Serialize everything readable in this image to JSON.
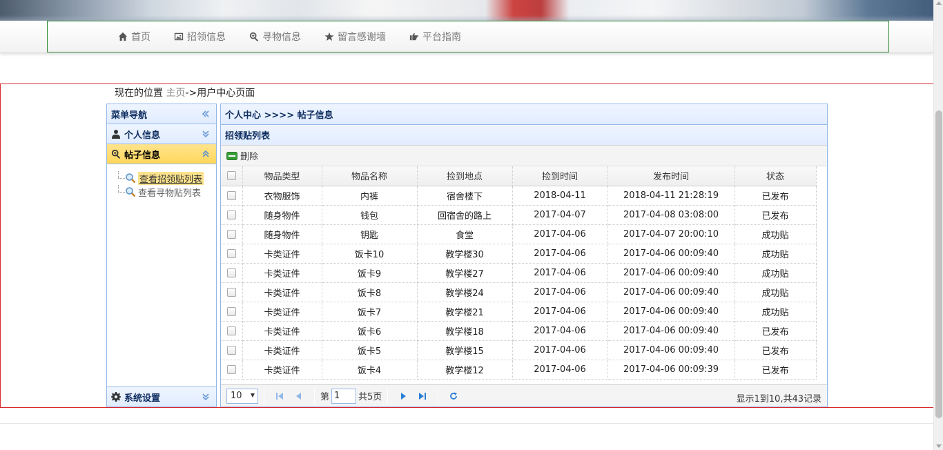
{
  "nav": {
    "items": [
      {
        "label": "首页",
        "icon": "home-icon"
      },
      {
        "label": "招领信息",
        "icon": "picture-icon"
      },
      {
        "label": "寻物信息",
        "icon": "zoom-in-icon"
      },
      {
        "label": "留言感谢墙",
        "icon": "star-icon"
      },
      {
        "label": "平台指南",
        "icon": "hand-right-icon"
      }
    ]
  },
  "breadcrumb": {
    "prefix": "现在的位置",
    "home": "主页",
    "current": "->用户中心页面"
  },
  "menu": {
    "title": "菜单导航",
    "personal": "个人信息",
    "posts": "帖子信息",
    "tree": [
      "查看招领贴列表",
      "查看寻物贴列表"
    ],
    "settings": "系统设置"
  },
  "content": {
    "path": "个人中心 >>>> 帖子信息",
    "list_title": "招领贴列表",
    "delete_label": "删除",
    "columns": [
      "物品类型",
      "物品名称",
      "捡到地点",
      "捡到时间",
      "发布时间",
      "状态"
    ],
    "rows": [
      [
        "衣物服饰",
        "内裤",
        "宿舍楼下",
        "2018-04-11",
        "2018-04-11 21:28:19",
        "已发布"
      ],
      [
        "随身物件",
        "钱包",
        "回宿舍的路上",
        "2017-04-07",
        "2017-04-08 03:08:00",
        "已发布"
      ],
      [
        "随身物件",
        "钥匙",
        "食堂",
        "2017-04-06",
        "2017-04-07 20:00:10",
        "成功贴"
      ],
      [
        "卡类证件",
        "饭卡10",
        "教学楼30",
        "2017-04-06",
        "2017-04-06 00:09:40",
        "成功贴"
      ],
      [
        "卡类证件",
        "饭卡9",
        "教学楼27",
        "2017-04-06",
        "2017-04-06 00:09:40",
        "成功贴"
      ],
      [
        "卡类证件",
        "饭卡8",
        "教学楼24",
        "2017-04-06",
        "2017-04-06 00:09:40",
        "成功贴"
      ],
      [
        "卡类证件",
        "饭卡7",
        "教学楼21",
        "2017-04-06",
        "2017-04-06 00:09:40",
        "成功贴"
      ],
      [
        "卡类证件",
        "饭卡6",
        "教学楼18",
        "2017-04-06",
        "2017-04-06 00:09:40",
        "已发布"
      ],
      [
        "卡类证件",
        "饭卡5",
        "教学楼15",
        "2017-04-06",
        "2017-04-06 00:09:40",
        "已发布"
      ],
      [
        "卡类证件",
        "饭卡4",
        "教学楼12",
        "2017-04-06",
        "2017-04-06 00:09:39",
        "已发布"
      ]
    ]
  },
  "pager": {
    "page_size": "10",
    "page_prefix": "第",
    "page_value": "1",
    "page_total": "共5页",
    "summary": "显示1到10,共43记录"
  }
}
